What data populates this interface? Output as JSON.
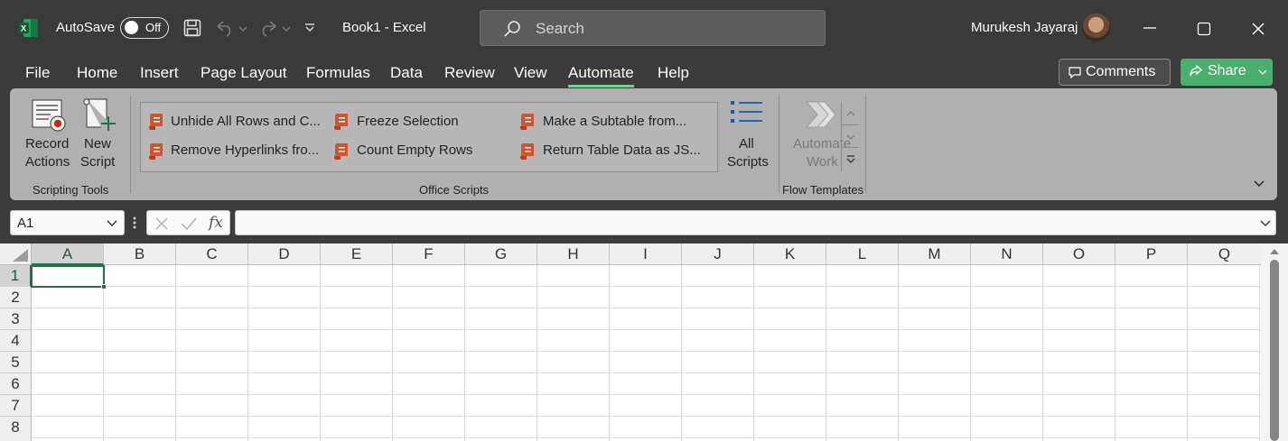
{
  "title_bar": {
    "autosave_label": "AutoSave",
    "autosave_state": "Off",
    "document_title": "Book1  -  Excel",
    "search_placeholder": "Search",
    "user_name": "Murukesh Jayaraj"
  },
  "menu": {
    "tabs": [
      "File",
      "Home",
      "Insert",
      "Page Layout",
      "Formulas",
      "Data",
      "Review",
      "View",
      "Automate",
      "Help"
    ],
    "active_tab": "Automate",
    "comments_label": "Comments",
    "share_label": "Share"
  },
  "ribbon": {
    "scripting_tools": {
      "group_label": "Scripting Tools",
      "record_actions": [
        "Record",
        "Actions"
      ],
      "new_script": [
        "New",
        "Script"
      ]
    },
    "office_scripts": {
      "group_label": "Office Scripts",
      "scripts": [
        "Unhide All Rows and C...",
        "Freeze Selection",
        "Make a Subtable from...",
        "Remove Hyperlinks fro...",
        "Count Empty Rows",
        "Return Table Data as JS..."
      ],
      "all_scripts": [
        "All",
        "Scripts"
      ]
    },
    "flow_templates": {
      "group_label": "Flow Templates",
      "automate_work": [
        "Automate",
        "Work"
      ]
    }
  },
  "formula_bar": {
    "name_box": "A1",
    "fx_label": "fx",
    "formula": ""
  },
  "grid": {
    "columns": [
      "A",
      "B",
      "C",
      "D",
      "E",
      "F",
      "G",
      "H",
      "I",
      "J",
      "K",
      "L",
      "M",
      "N",
      "O",
      "P",
      "Q"
    ],
    "rows": [
      "1",
      "2",
      "3",
      "4",
      "5",
      "6",
      "7",
      "8"
    ],
    "active_cell": "A1"
  },
  "colors": {
    "accent_green": "#1f7246",
    "tab_underline": "#6dd39a",
    "share_button": "#49b06e"
  }
}
